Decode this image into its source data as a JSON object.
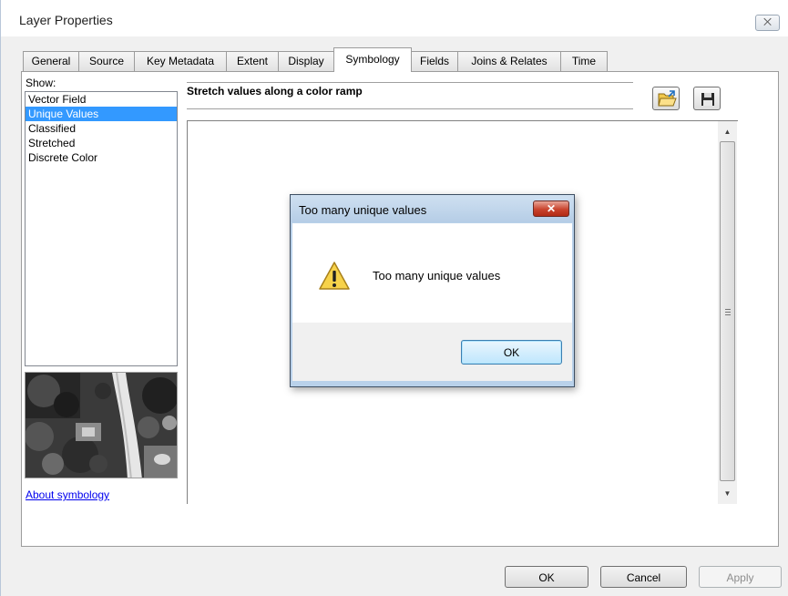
{
  "window": {
    "title": "Layer Properties",
    "close_glyph": "⨉"
  },
  "tabs": [
    {
      "label": "General"
    },
    {
      "label": "Source"
    },
    {
      "label": "Key Metadata"
    },
    {
      "label": "Extent"
    },
    {
      "label": "Display"
    },
    {
      "label": "Symbology",
      "active": true
    },
    {
      "label": "Fields"
    },
    {
      "label": "Joins & Relates"
    },
    {
      "label": "Time"
    }
  ],
  "symbology": {
    "show_label": "Show:",
    "show_items": [
      {
        "label": "Vector Field"
      },
      {
        "label": "Unique Values",
        "selected": true
      },
      {
        "label": "Classified"
      },
      {
        "label": "Stretched"
      },
      {
        "label": "Discrete Color"
      }
    ],
    "heading": "Stretch values along a color ramp",
    "about_link": "About symbology"
  },
  "footer": {
    "ok": "OK",
    "cancel": "Cancel",
    "apply": "Apply"
  },
  "message_box": {
    "title": "Too many unique values",
    "text": "Too many unique values",
    "ok": "OK",
    "close_glyph": "✕"
  },
  "icons": {
    "open_icon": "folder-open-icon",
    "save_icon": "floppy-disk-icon",
    "warning_icon": "warning-triangle-icon"
  },
  "colors": {
    "selection": "#3399ff",
    "link": "#0000ee",
    "dialog_frame": "#b9d1ea",
    "close_red": "#c9432d"
  }
}
